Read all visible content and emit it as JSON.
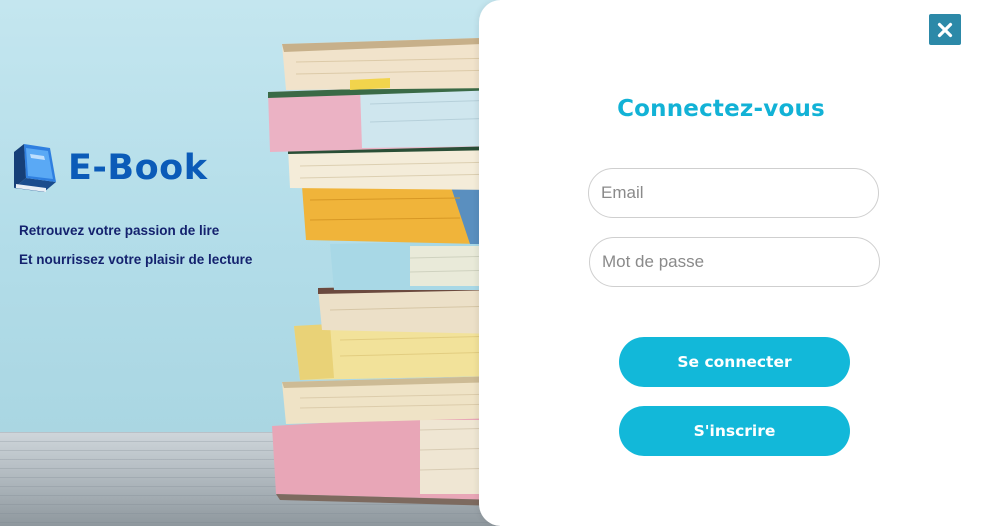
{
  "brand": {
    "name": "E-Book",
    "tagline_line1": "Retrouvez votre passion de lire",
    "tagline_line2": "Et nourrissez votre plaisir de lecture",
    "icon": "book-logo-icon"
  },
  "login": {
    "title": "Connectez-vous",
    "email_placeholder": "Email",
    "email_value": "",
    "password_placeholder": "Mot de passe",
    "password_value": "",
    "login_label": "Se connecter",
    "signup_label": "S'inscrire"
  },
  "window": {
    "close_icon": "close-icon"
  },
  "colors": {
    "accent": "#12b8d9",
    "title": "#12b2d6",
    "brand": "#0b5bb8",
    "tagline": "#14226e",
    "close_button": "#2c89a8",
    "background_left": "#b3dde9"
  }
}
